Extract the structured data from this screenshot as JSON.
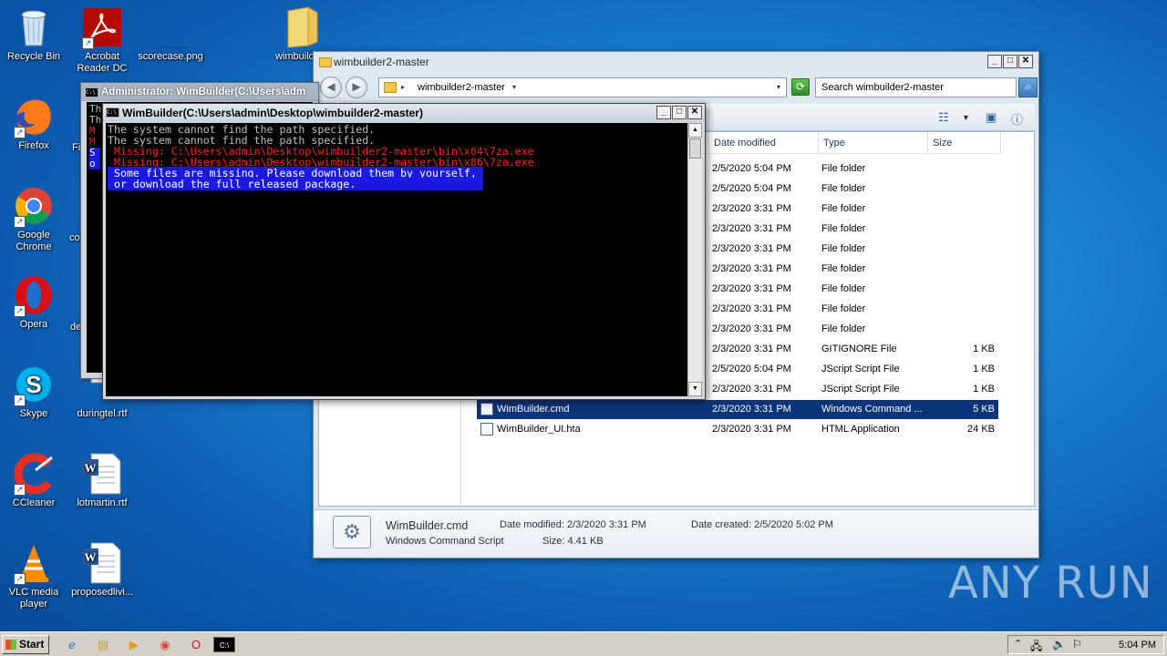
{
  "desktop": {
    "icons": [
      {
        "label": "Recycle Bin",
        "icon": "recycle-bin-icon"
      },
      {
        "label": "Acrobat Reader DC",
        "icon": "acrobat-icon"
      },
      {
        "label": "scorecase.png",
        "icon": "image-file-icon"
      },
      {
        "label": "wimbuild",
        "icon": "folder-icon"
      },
      {
        "label": "Firefox",
        "icon": "firefox-icon"
      },
      {
        "label": "Fi",
        "icon": "file-icon"
      },
      {
        "label": "Google Chrome",
        "icon": "chrome-icon"
      },
      {
        "label": "co",
        "icon": "file-icon"
      },
      {
        "label": "Opera",
        "icon": "opera-icon"
      },
      {
        "label": "de",
        "icon": "file-icon"
      },
      {
        "label": "Skype",
        "icon": "skype-icon"
      },
      {
        "label": "duringtel.rtf",
        "icon": "word-doc-icon"
      },
      {
        "label": "CCleaner",
        "icon": "ccleaner-icon"
      },
      {
        "label": "lotmartin.rtf",
        "icon": "word-doc-icon"
      },
      {
        "label": "VLC media player",
        "icon": "vlc-icon"
      },
      {
        "label": "proposedlivi...",
        "icon": "word-doc-icon"
      }
    ]
  },
  "console_back": {
    "title": "Administrator:  WimBuilder(C:\\Users\\adm",
    "visible_chars": [
      "Th",
      "Th",
      "M",
      "M",
      "S",
      "o"
    ]
  },
  "console_front": {
    "title": "WimBuilder(C:\\Users\\admin\\Desktop\\wimbuilder2-master)",
    "lines": [
      {
        "text": "The system cannot find the path specified.",
        "style": "white"
      },
      {
        "text": "The system cannot find the path specified.",
        "style": "white"
      },
      {
        "text": " Missing: C:\\Users\\admin\\Desktop\\wimbuilder2-master\\bin\\x64\\7za.exe",
        "style": "red"
      },
      {
        "text": " Missing: C:\\Users\\admin\\Desktop\\wimbuilder2-master\\bin\\x86\\7za.exe",
        "style": "red"
      },
      {
        "text": " Some files are missing. Please download them by yourself, ",
        "style": "sel"
      },
      {
        "text": " or download the full released package.                    ",
        "style": "sel"
      }
    ]
  },
  "explorer": {
    "title": "wimbuilder2-master",
    "address": "wimbuilder2-master",
    "search_placeholder": "Search wimbuilder2-master",
    "columns": {
      "date": "Date modified",
      "type": "Type",
      "size": "Size"
    },
    "rows": [
      {
        "name": "",
        "date": "2/5/2020 5:04 PM",
        "type": "File folder",
        "size": ""
      },
      {
        "name": "",
        "date": "2/5/2020 5:04 PM",
        "type": "File folder",
        "size": ""
      },
      {
        "name": "",
        "date": "2/3/2020 3:31 PM",
        "type": "File folder",
        "size": ""
      },
      {
        "name": "",
        "date": "2/3/2020 3:31 PM",
        "type": "File folder",
        "size": ""
      },
      {
        "name": "",
        "date": "2/3/2020 3:31 PM",
        "type": "File folder",
        "size": ""
      },
      {
        "name": "",
        "date": "2/3/2020 3:31 PM",
        "type": "File folder",
        "size": ""
      },
      {
        "name": "",
        "date": "2/3/2020 3:31 PM",
        "type": "File folder",
        "size": ""
      },
      {
        "name": "",
        "date": "2/3/2020 3:31 PM",
        "type": "File folder",
        "size": ""
      },
      {
        "name": "",
        "date": "2/3/2020 3:31 PM",
        "type": "File folder",
        "size": ""
      },
      {
        "name": "",
        "date": "2/3/2020 3:31 PM",
        "type": "GITIGNORE File",
        "size": "1 KB"
      },
      {
        "name": "",
        "date": "2/5/2020 5:04 PM",
        "type": "JScript Script File",
        "size": "1 KB"
      },
      {
        "name": "",
        "date": "2/3/2020 3:31 PM",
        "type": "JScript Script File",
        "size": "1 KB"
      },
      {
        "name": "WimBuilder.cmd",
        "date": "2/3/2020 3:31 PM",
        "type": "Windows Command ...",
        "size": "5 KB",
        "selected": true
      },
      {
        "name": "WimBuilder_UI.hta",
        "date": "2/3/2020 3:31 PM",
        "type": "HTML Application",
        "size": "24 KB"
      }
    ],
    "details": {
      "name": "WimBuilder.cmd",
      "kind": "Windows Command Script",
      "date_modified": "Date modified:  2/3/2020 3:31 PM",
      "date_created": "Date created:  2/5/2020 5:02 PM",
      "size": "Size:  4.41 KB"
    }
  },
  "watermark": "ANY RUN",
  "taskbar": {
    "start_label": "Start",
    "clock": "5:04 PM",
    "pinned": [
      "ie-icon",
      "explorer-icon",
      "media-player-icon",
      "chrome-icon",
      "opera-icon",
      "cmd-icon"
    ]
  },
  "colors": {
    "desktop": "#1c7fd0",
    "console_red": "#ff2121",
    "console_selection": "#1a1adf",
    "explorer_selection": "#0b3578"
  }
}
